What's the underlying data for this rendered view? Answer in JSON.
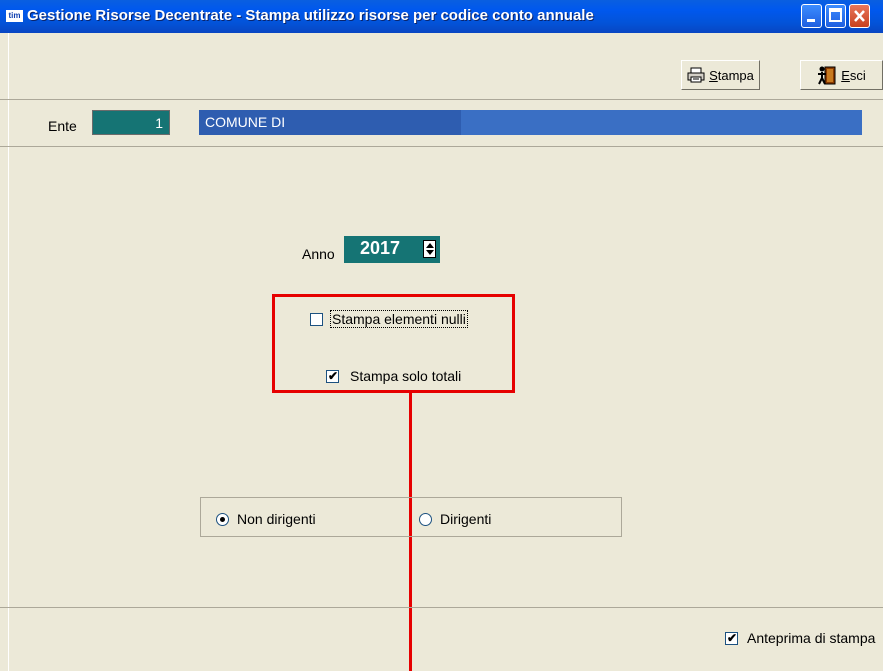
{
  "window": {
    "title": "Gestione Risorse Decentrate - Stampa utilizzo risorse per codice conto annuale",
    "app_icon_text": "tim"
  },
  "toolbar": {
    "stampa_label": "Stampa",
    "esci_label": "Esci"
  },
  "ente": {
    "label": "Ente",
    "code": "1",
    "name": "COMUNE DI"
  },
  "form": {
    "anno_label": "Anno",
    "anno_value": "2017",
    "stampa_elementi_nulli": {
      "label": "Stampa elementi nulli",
      "checked": false
    },
    "stampa_solo_totali": {
      "label": "Stampa solo totali",
      "checked": true
    },
    "categoria": {
      "options": [
        "Non dirigenti",
        "Dirigenti"
      ],
      "selected": "Non dirigenti"
    }
  },
  "footer": {
    "anteprima": {
      "label": "Anteprima di stampa",
      "checked": true
    }
  },
  "colors": {
    "titlebar": "#0058EE",
    "field_teal": "#157474",
    "ente_name_bg": "#3A6FC4",
    "annotation_red": "#E60000",
    "window_bg": "#ECE9D8"
  }
}
